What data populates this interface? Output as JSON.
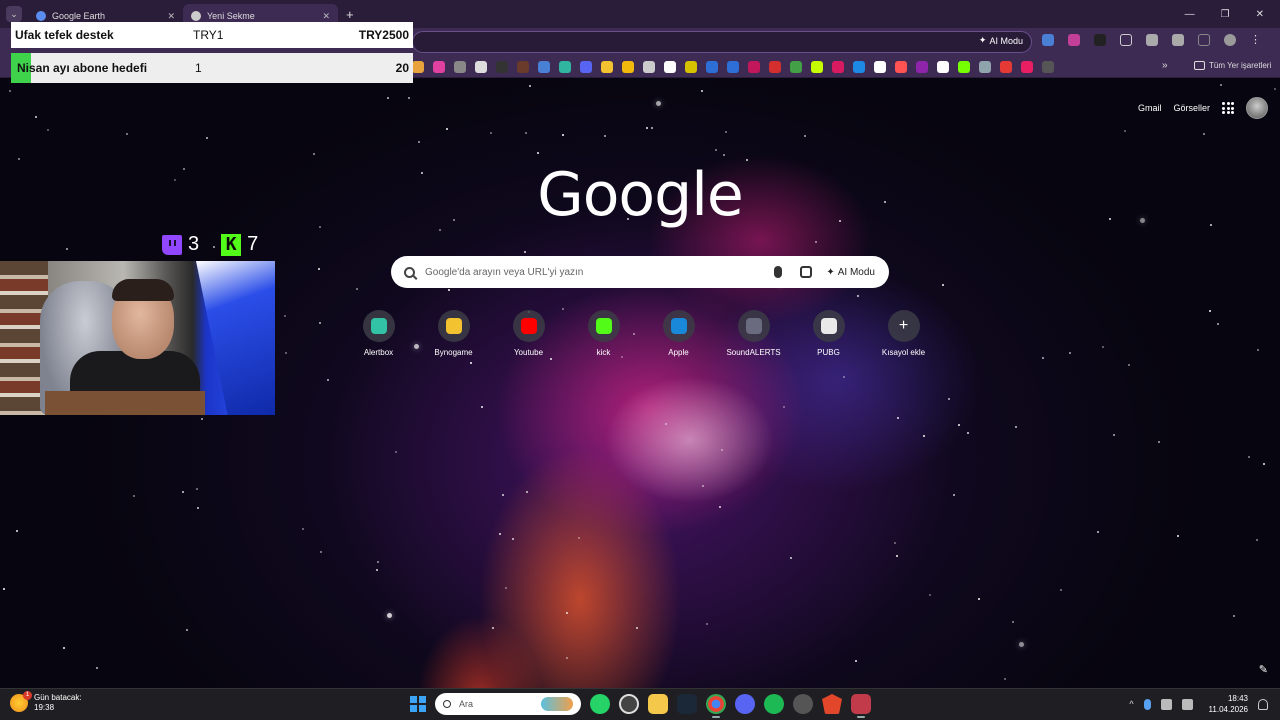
{
  "browser": {
    "tabs": [
      {
        "title": "Google Earth",
        "active": false
      },
      {
        "title": "Yeni Sekme",
        "active": true
      }
    ],
    "omnibox_ai_label": "AI Modu",
    "bookmarks_folder": "Tüm Yer işaretleri"
  },
  "overlay": {
    "goals": [
      {
        "name": "Ufak tefek destek",
        "current": "TRY1",
        "target": "TRY2500",
        "progress": 0.0004
      },
      {
        "name": "Nisan ayı abone hedefi",
        "current": "1",
        "target": "20",
        "progress": 0.05
      }
    ],
    "twitch_count": "3",
    "kick_count": "7"
  },
  "newtab": {
    "top_links": {
      "gmail": "Gmail",
      "images": "Görseller"
    },
    "logo": "Google",
    "search_placeholder": "Google'da arayın veya URL'yi yazın",
    "ai_mode_label": "AI Modu",
    "shortcuts": [
      {
        "label": "Alertbox",
        "icon": "alertbox-icon",
        "color": "#32c3a6"
      },
      {
        "label": "Bynogame",
        "icon": "bynogame-icon",
        "color": "#f2c230"
      },
      {
        "label": "Youtube",
        "icon": "youtube-icon",
        "color": "#ff0000"
      },
      {
        "label": "kick",
        "icon": "kick-icon",
        "color": "#53fc18"
      },
      {
        "label": "Apple",
        "icon": "apple-icon",
        "color": "#1a88d9"
      },
      {
        "label": "SoundALERTS",
        "icon": "soundalerts-icon",
        "color": "#6b6b80"
      },
      {
        "label": "PUBG",
        "icon": "pubg-icon",
        "color": "#e9e9e9"
      },
      {
        "label": "Kısayol ekle",
        "icon": "plus-icon",
        "color": "#ffffff"
      }
    ]
  },
  "taskbar": {
    "weather_title": "Gün batacak:",
    "weather_time": "19:38",
    "search_placeholder": "Ara",
    "time": "18:43",
    "date": "11.04.2026"
  },
  "colors": {
    "accent": "#6a4f8a",
    "goal_fill": "#3fd34c"
  }
}
